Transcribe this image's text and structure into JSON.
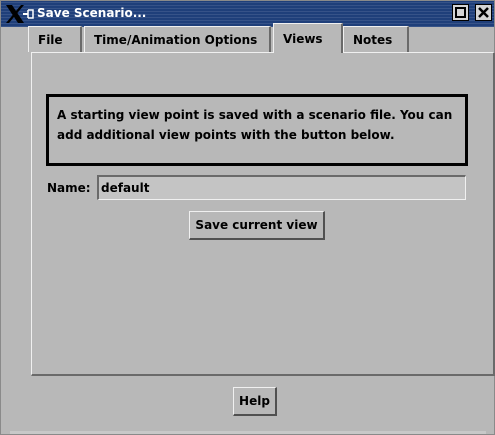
{
  "window": {
    "title": "Save Scenario...",
    "logo_icon": "x-window-logo-icon",
    "maximize_icon": "maximize-icon",
    "close_icon": "close-icon"
  },
  "tabs": [
    {
      "label": "File",
      "active": false
    },
    {
      "label": "Time/Animation Options",
      "active": false
    },
    {
      "label": "Views",
      "active": true
    },
    {
      "label": "Notes",
      "active": false
    }
  ],
  "views": {
    "info_text": "A starting view point is saved with a scenario file.  You can\nadd additional view points with the button below.",
    "name_label": "Name:",
    "name_value": "default",
    "save_button": "Save current view"
  },
  "footer": {
    "help_button": "Help"
  }
}
